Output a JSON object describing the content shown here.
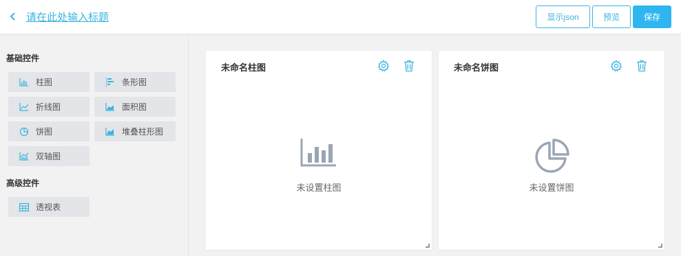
{
  "header": {
    "title": "请在此处输入标题",
    "buttons": {
      "show_json": "显示json",
      "preview": "预览",
      "save": "保存"
    }
  },
  "sidebar": {
    "basic_title": "基础控件",
    "basic_items": [
      {
        "label": "柱图",
        "icon": "bar-chart-icon"
      },
      {
        "label": "条形图",
        "icon": "horizontal-bar-chart-icon"
      },
      {
        "label": "折线图",
        "icon": "line-chart-icon"
      },
      {
        "label": "面积图",
        "icon": "area-chart-icon"
      },
      {
        "label": "饼图",
        "icon": "pie-chart-icon"
      },
      {
        "label": "堆叠柱形图",
        "icon": "stacked-area-chart-icon"
      },
      {
        "label": "双轴图",
        "icon": "dual-axis-chart-icon"
      }
    ],
    "advanced_title": "高级控件",
    "advanced_items": [
      {
        "label": "透视表",
        "icon": "table-icon"
      }
    ]
  },
  "canvas": {
    "cards": [
      {
        "name": "未命名柱图",
        "empty_text": "未设置柱图",
        "icon": "bar-chart-icon"
      },
      {
        "name": "未命名饼图",
        "empty_text": "未设置饼图",
        "icon": "pie-chart-icon"
      }
    ]
  },
  "colors": {
    "accent": "#3ab3df",
    "save_bg": "#2fb6f0",
    "placeholder_icon": "#9aa5b5"
  }
}
